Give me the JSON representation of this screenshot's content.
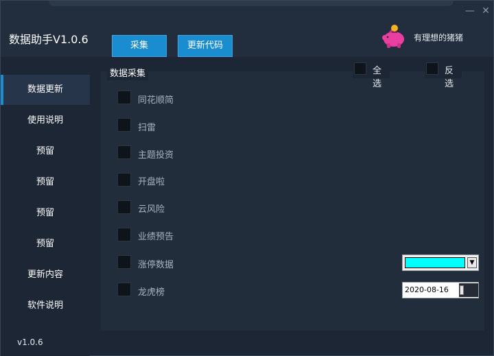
{
  "app": {
    "title": "数据助手V1.0.6",
    "slogan": "有理想的猪猪"
  },
  "window_controls": {
    "minimize_icon": "minimize-icon",
    "close_icon": "close-icon"
  },
  "toolbar": {
    "collect_label": "采集",
    "update_code_label": "更新代码"
  },
  "sidebar": {
    "items": [
      {
        "label": "数据更新",
        "active": true
      },
      {
        "label": "使用说明",
        "active": false
      },
      {
        "label": "预留",
        "active": false
      },
      {
        "label": "预留",
        "active": false
      },
      {
        "label": "预留",
        "active": false
      },
      {
        "label": "预留",
        "active": false
      },
      {
        "label": "更新内容",
        "active": false
      },
      {
        "label": "软件说明",
        "active": false
      }
    ],
    "version": "v1.0.6"
  },
  "collect_group": {
    "title": "数据采集",
    "select_all_label": "全选",
    "invert_label": "反选",
    "items": [
      {
        "label": "同花顺简",
        "checked": false
      },
      {
        "label": "扫雷",
        "checked": false
      },
      {
        "label": "主题投资",
        "checked": false
      },
      {
        "label": "开盘啦",
        "checked": false
      },
      {
        "label": "云风险",
        "checked": false
      },
      {
        "label": "业绩预告",
        "checked": false
      },
      {
        "label": "涨停数据",
        "checked": false
      },
      {
        "label": "龙虎榜",
        "checked": false
      }
    ]
  },
  "color_picker": {
    "value": "#00ffff"
  },
  "date_picker": {
    "value": "2020-08-16"
  },
  "colors": {
    "accent": "#1a8dd0",
    "background": "#1c2634",
    "panel": "#222d3c",
    "pig": "#e83fa0",
    "coin": "#f5b323"
  }
}
